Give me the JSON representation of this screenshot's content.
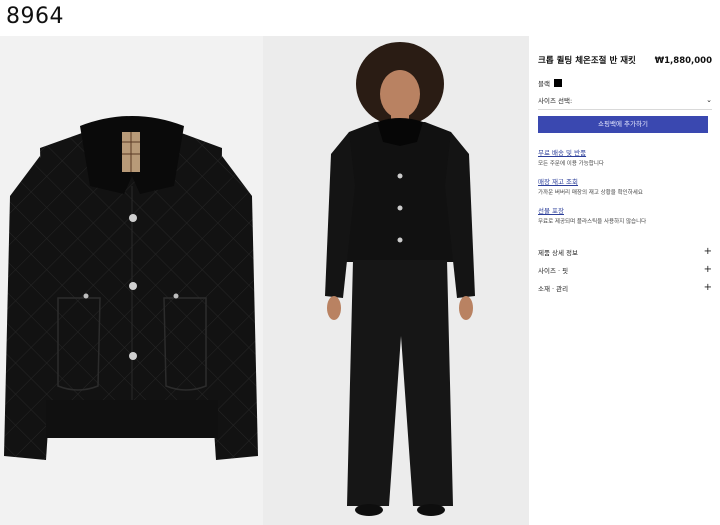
{
  "code_label": "8964",
  "product": {
    "title": "크롭 퀼팅 체온조절 반 재킷",
    "price": "₩1,880,000",
    "color_label": "블랙",
    "color_hex": "#000000",
    "size_label": "사이즈 선택:",
    "add_to_cart": "쇼핑백에 추가하기"
  },
  "services": [
    {
      "title": "무료 배송 및 반품",
      "desc": "모든 주문에 이용 가능합니다"
    },
    {
      "title": "매장 재고 조회",
      "desc": "가까운 버버리 매장의 재고 상황을 확인하세요"
    },
    {
      "title": "선물 포장",
      "desc": "무료로 제공되며 플라스틱을 사용하지 않습니다"
    }
  ],
  "accordion": [
    {
      "label": "제품 상세 정보",
      "icon": "plus-icon"
    },
    {
      "label": "사이즈 · 핏",
      "icon": "plus-icon"
    },
    {
      "label": "소재 · 관리",
      "icon": "plus-icon"
    }
  ],
  "colors": {
    "accent": "#3a48b0",
    "link": "#2c3f9a"
  }
}
